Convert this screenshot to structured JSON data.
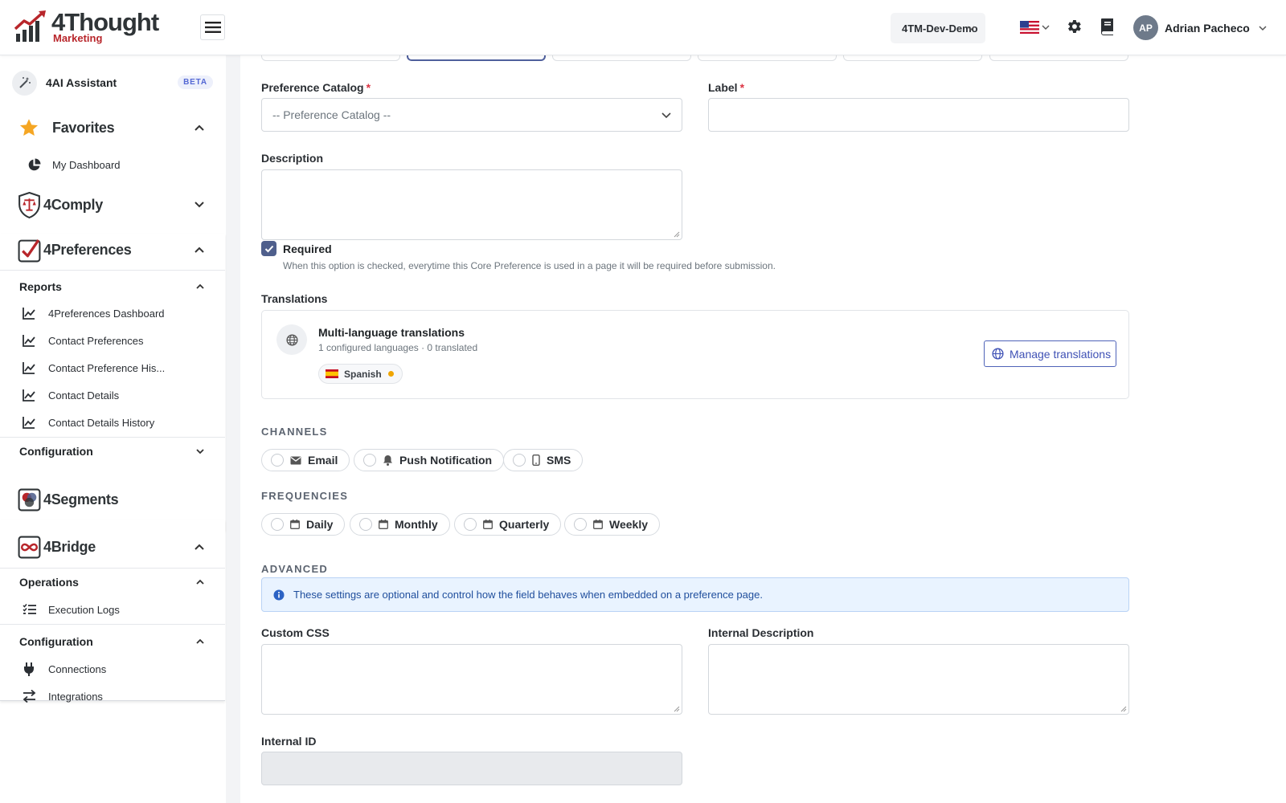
{
  "brand": {
    "name": "4Thought",
    "sub": "Marketing"
  },
  "header": {
    "environment": "4TM-Dev-Demo",
    "user_initials": "AP",
    "user_name": "Adrian Pacheco"
  },
  "sidebar": {
    "assistant": {
      "label": "4AI Assistant",
      "badge": "BETA"
    },
    "favorites": {
      "label": "Favorites",
      "items": [
        "My Dashboard"
      ]
    },
    "comply": {
      "label": "4Comply"
    },
    "preferences": {
      "label": "4Preferences",
      "reports": {
        "label": "Reports",
        "items": [
          "4Preferences Dashboard",
          "Contact Preferences",
          "Contact Preference His...",
          "Contact Details",
          "Contact Details History"
        ]
      },
      "configuration": {
        "label": "Configuration"
      }
    },
    "segments": {
      "label": "4Segments"
    },
    "bridge": {
      "label": "4Bridge",
      "operations": {
        "label": "Operations",
        "items": [
          "Execution Logs"
        ]
      },
      "configuration": {
        "label": "Configuration",
        "items": [
          "Connections",
          "Integrations"
        ]
      }
    }
  },
  "form": {
    "catalog_label": "Preference Catalog",
    "catalog_placeholder": "-- Preference Catalog --",
    "label_label": "Label",
    "required_mark": "*",
    "description_label": "Description",
    "required_label": "Required",
    "required_checked": true,
    "required_help": "When this option is checked, everytime this Core Preference is used in a page it will be required before submission.",
    "translations_label": "Translations",
    "translations": {
      "title": "Multi-language translations",
      "meta": "1 configured languages · 0 translated",
      "language": "Spanish",
      "manage_button": "Manage translations"
    },
    "channels_heading": "CHANNELS",
    "channels": [
      "Email",
      "Push Notification",
      "SMS"
    ],
    "frequencies_heading": "FREQUENCIES",
    "frequencies": [
      "Daily",
      "Monthly",
      "Quarterly",
      "Weekly"
    ],
    "advanced_heading": "ADVANCED",
    "advanced_info": "These settings are optional and control how the field behaves when embedded on a preference page.",
    "custom_css_label": "Custom CSS",
    "internal_description_label": "Internal Description",
    "internal_id_label": "Internal ID"
  },
  "colors": {
    "accent": "#3f51b5",
    "brand_red": "#b8262b",
    "checkbox": "#4f5f8c",
    "info_bg": "#e9f3ff"
  }
}
